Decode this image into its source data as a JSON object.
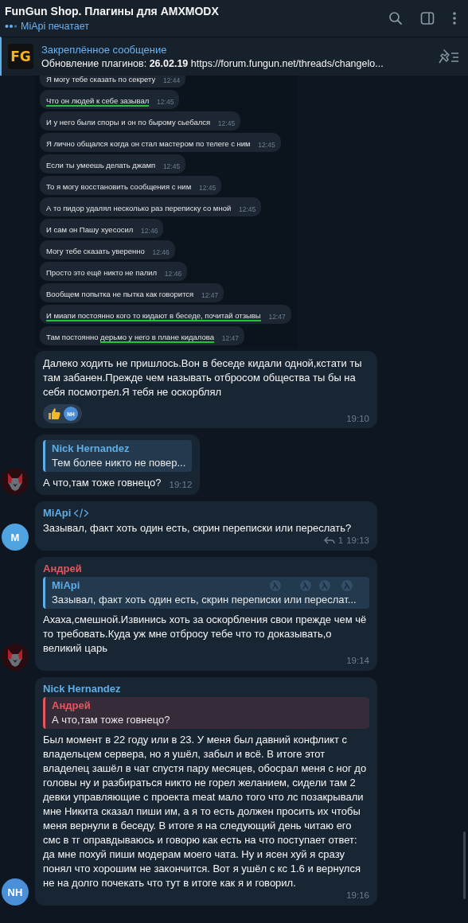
{
  "header": {
    "title": "FunGun Shop. Плагины для AMXMODX",
    "status": "MiApi печатает",
    "typing": true
  },
  "pinned": {
    "logo_text": "FG",
    "label": "Закреплённое сообщение",
    "text": "Обновление плагинов: **26.02.19**  https://forum.fungun.net/threads/changelo..."
  },
  "messages": [
    {
      "kind": "screenshot",
      "screenshot_lines": [
        {
          "parts": [
            {
              "text": "Я могу тебе сказать по секрету",
              "underlined": false
            }
          ],
          "time": "12:44"
        },
        {
          "parts": [
            {
              "text": "Что он людей к себе зазывал",
              "underlined": true
            }
          ],
          "time": "12:45"
        },
        {
          "parts": [
            {
              "text": "И у него были споры и он по бырому сьебался",
              "underlined": false
            }
          ],
          "time": "12:45"
        },
        {
          "parts": [
            {
              "text": "Я лично общался когда он стал мастером по телеге с ним",
              "underlined": false
            }
          ],
          "time": "12:45"
        },
        {
          "parts": [
            {
              "text": "Если ты умеешь делать джамп",
              "underlined": false
            }
          ],
          "time": "12:45"
        },
        {
          "parts": [
            {
              "text": "То я могу восстановить сообщения с ним",
              "underlined": false
            }
          ],
          "time": "12:45"
        },
        {
          "parts": [
            {
              "text": "А то пидор удалял несколько раз переписку со мной",
              "underlined": false
            }
          ],
          "time": "12:45"
        },
        {
          "parts": [
            {
              "text": "И сам он Пашу хуесосил",
              "underlined": false
            }
          ],
          "time": "12:46"
        },
        {
          "parts": [
            {
              "text": "Могу тебе сказать уверенно",
              "underlined": false
            }
          ],
          "time": "12:46"
        },
        {
          "parts": [
            {
              "text": "Просто это ещё никто не палил",
              "underlined": false
            }
          ],
          "time": "12:46"
        },
        {
          "parts": [
            {
              "text": "Вообщем попытка не пытка как говорится",
              "underlined": false
            }
          ],
          "time": "12:47"
        },
        {
          "parts": [
            {
              "text": "И миапи постоянно кого то кидают в беседе, почитай отзывы",
              "underlined": true
            }
          ],
          "time": "12:47"
        },
        {
          "parts": [
            {
              "text": "Там постоянно ",
              "underlined": false
            },
            {
              "text": "дерьмо у него в плане кидалова",
              "underlined": true
            }
          ],
          "time": "12:47"
        }
      ],
      "text": "Далеко ходить не пришлось.Вон в беседе кидали одной,кстати ты там забанен.Прежде чем называть отбросом общества ты бы на себя посмотрел.Я тебя не оскорблял",
      "reactions": [
        {
          "kind": "thumbs-up"
        },
        {
          "kind": "avatar",
          "text": "NH",
          "color": "#4a90d9"
        }
      ],
      "time": "19:10"
    },
    {
      "kind": "text",
      "avatar": {
        "kind": "wolf"
      },
      "reply": {
        "sender": "Nick Hernandez",
        "color": "#5eaee8",
        "text": "Тем более никто не повер..."
      },
      "text": "А что,там тоже говнецо?",
      "time": "19:12"
    },
    {
      "kind": "text",
      "avatar": {
        "kind": "initials",
        "text": "M",
        "color": "#4fa3e0"
      },
      "sender": "MiApi",
      "color": "#5eaee8",
      "sender_badge": true,
      "text": "Зазывал, факт хоть один есть, скрин переписки или переслать?",
      "replies": "1",
      "time": "19:13"
    },
    {
      "kind": "text",
      "avatar": {
        "kind": "wolf"
      },
      "sender": "Андрей",
      "color": "#e5575f",
      "reply": {
        "sender": "MiApi",
        "color": "#5eaee8",
        "text": "Зазывал, факт хоть один есть, скрин переписки или переслат...",
        "pattern": true
      },
      "text": "Ахаха,смешной.Извинись хоть за оскорбления свои прежде чем чё то требовать.Куда уж мне отбросу тебе что то доказывать,о великий царь",
      "time": "19:14"
    },
    {
      "kind": "text",
      "avatar": {
        "kind": "initials",
        "text": "NH",
        "color": "#4a90d9"
      },
      "sender": "Nick Hernandez",
      "color": "#5eaee8",
      "reply": {
        "sender": "Андрей",
        "color": "#e5575f",
        "text": "А что,там тоже говнецо?"
      },
      "text": "Был момент в 22 году или в 23. У меня был давний конфликт с владельцем сервера, но я ушёл, забыл и всё. В итоге этот владелец зашёл в чат спустя пару месяцев, обосрал меня с ног до головы ну и разбираться никто не горел желанием, сидели там 2 девки управляющие с проекта meat мало того что лс позакрывали мне Никита сказал пиши им, а я то есть должен просить их чтобы меня вернули в беседу. В итоге я на следующий день читаю его смс в тг оправдываюсь и говорю как есть на что поступает ответ: да мне похуй пиши модерам моего чата. Ну и ясен хуй я сразу понял что хорошим не закончится. Вот я ушёл с кс 1.6 и вернулся не на долго почекать что тут в итоге как я и говорил.",
      "time": "19:16"
    }
  ]
}
